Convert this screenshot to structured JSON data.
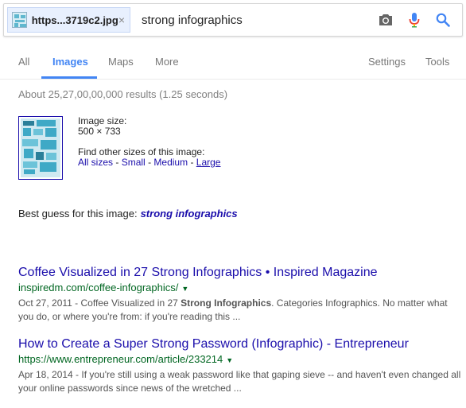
{
  "search": {
    "chip_filename": "https...3719c2.jpg",
    "chip_close": "×",
    "query": "strong infographics"
  },
  "tabs": [
    {
      "label": "All"
    },
    {
      "label": "Images",
      "active": true
    },
    {
      "label": "Maps"
    },
    {
      "label": "More"
    },
    {
      "label": "Settings"
    },
    {
      "label": "Tools"
    }
  ],
  "result_stats": "About 25,27,00,00,000 results (1.25 seconds)",
  "image_info": {
    "size_label": "Image size:",
    "size_value": "500 × 733",
    "find_label": "Find other sizes of this image:",
    "sizes": [
      "All sizes",
      "Small",
      "Medium",
      "Large"
    ],
    "separator": "-"
  },
  "best_guess": {
    "label": "Best guess for this image:",
    "value": "strong infographics"
  },
  "results": [
    {
      "title": "Coffee Visualized in 27 Strong Infographics • Inspired Magazine",
      "url": "inspiredm.com/coffee-infographics/",
      "date": "Oct 27, 2011",
      "snippet_pre": " - Coffee Visualized in 27 ",
      "snippet_bold": "Strong Infographics",
      "snippet_post": ". Categories Infographics. No matter what you do, or where you're from: if you're reading this ..."
    },
    {
      "title": "How to Create a Super Strong Password (Infographic) - Entrepreneur",
      "url": "https://www.entrepreneur.com/article/233214",
      "date": "Apr 18, 2014",
      "snippet_pre": " - If you're still using a weak password like that gaping sieve -- and haven't even changed all your online passwords since news of the wretched ...",
      "snippet_bold": "",
      "snippet_post": ""
    }
  ],
  "icons": {
    "camera": "camera-icon",
    "mic": "microphone-icon",
    "search": "search-icon",
    "close": "close-icon",
    "dropdown": "caret-down-icon"
  },
  "colors": {
    "link": "#1a0dab",
    "url_green": "#006621",
    "active_tab": "#4285f4",
    "snippet": "#545454"
  }
}
